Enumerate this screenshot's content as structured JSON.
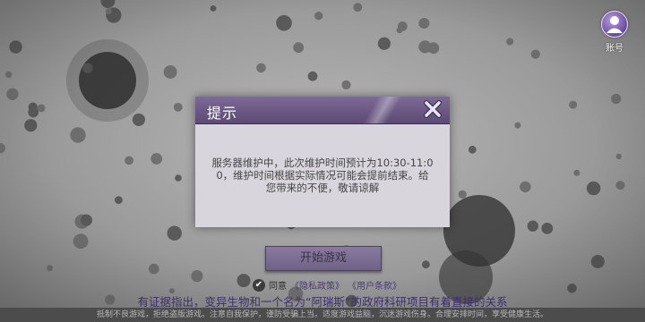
{
  "account": {
    "label": "账号",
    "icon": "user-icon"
  },
  "dialog": {
    "title": "提示",
    "close_icon": "close-x-icon",
    "message": "服务器维护中，此次维护时间预计为10:30-11:00，维护时间根据实际情况可能会提前结束。给您带来的不便，敬请谅解"
  },
  "start_button": {
    "label": "开始游戏"
  },
  "agreement": {
    "check_icon": "checkmark-icon",
    "prefix": "同意",
    "privacy": "《隐私政策》",
    "terms": "《用户条款》"
  },
  "story_line": "有证据指出，变异生物和一个名为“阿瑞斯”的政府科研项目有着直接的关系",
  "footer": "抵制不良游戏，拒绝盗版游戏。注意自我保护，谨防受骗上当。适度游戏益脑，沉迷游戏伤身。合理安排时间，享受健康生活。",
  "colors": {
    "accent_purple": "#5b4a73",
    "body_bg": "#d8d6dc"
  }
}
